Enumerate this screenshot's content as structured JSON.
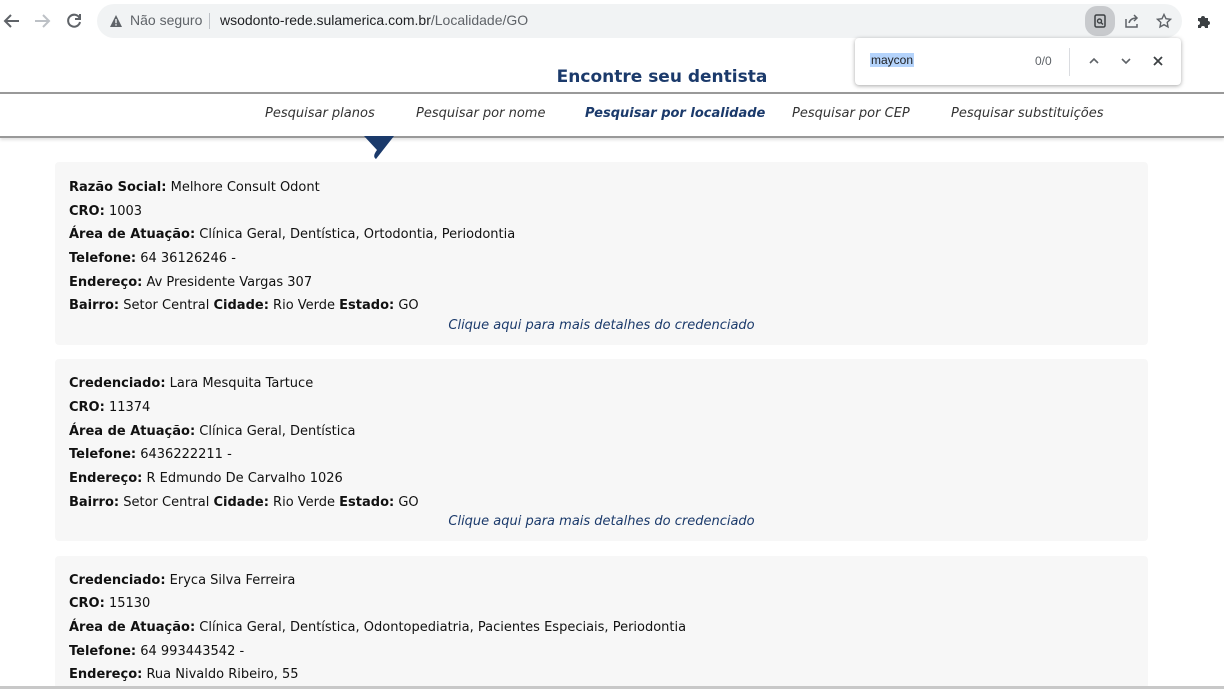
{
  "browser": {
    "security_label": "Não seguro",
    "url_host": "wsodonto-rede.sulamerica.com.br",
    "url_path": "/Localidade/GO",
    "icons": [
      "back-arrow-icon",
      "forward-arrow-icon",
      "reload-icon",
      "warning-icon",
      "find-icon",
      "share-icon",
      "star-icon",
      "puzzle-icon"
    ]
  },
  "findbar": {
    "query": "maycon",
    "count": "0/0"
  },
  "page": {
    "title": "Encontre seu dentista",
    "tabs": [
      {
        "label": "Pesquisar planos"
      },
      {
        "label": "Pesquisar por nome"
      },
      {
        "label": "Pesquisar por localidade"
      },
      {
        "label": "Pesquisar por CEP"
      },
      {
        "label": "Pesquisar substituições"
      }
    ],
    "active_tab": "Pesquisar por localidade",
    "accent_color": "#1b3a6b"
  },
  "labels": {
    "razao": "Razão Social:",
    "credenciado": "Credenciado:",
    "cro": "CRO:",
    "area": "Área de Atuação:",
    "telefone": "Telefone:",
    "endereco": "Endereço:",
    "bairro": "Bairro:",
    "cidade": "Cidade:",
    "estado": "Estado:",
    "more": "Clique aqui para mais detalhes do credenciado"
  },
  "results": [
    {
      "name": "Melhore Consult Odont",
      "cro": "1003",
      "area": "Clínica Geral, Dentística, Ortodontia, Periodontia",
      "telefone": "64 36126246 -",
      "endereco": "Av Presidente Vargas 307",
      "bairro": "Setor Central",
      "cidade": "Rio Verde",
      "estado": "GO"
    },
    {
      "name": "Lara Mesquita Tartuce",
      "cro": "11374",
      "area": "Clínica Geral, Dentística",
      "telefone": "6436222211 -",
      "endereco": "R Edmundo De Carvalho 1026",
      "bairro": "Setor Central",
      "cidade": "Rio Verde",
      "estado": "GO"
    },
    {
      "name": "Eryca Silva Ferreira",
      "cro": "15130",
      "area": "Clínica Geral, Dentística, Odontopediatria, Pacientes Especiais, Periodontia",
      "telefone": "64 993443542 -",
      "endereco": "Rua Nivaldo Ribeiro, 55"
    }
  ]
}
